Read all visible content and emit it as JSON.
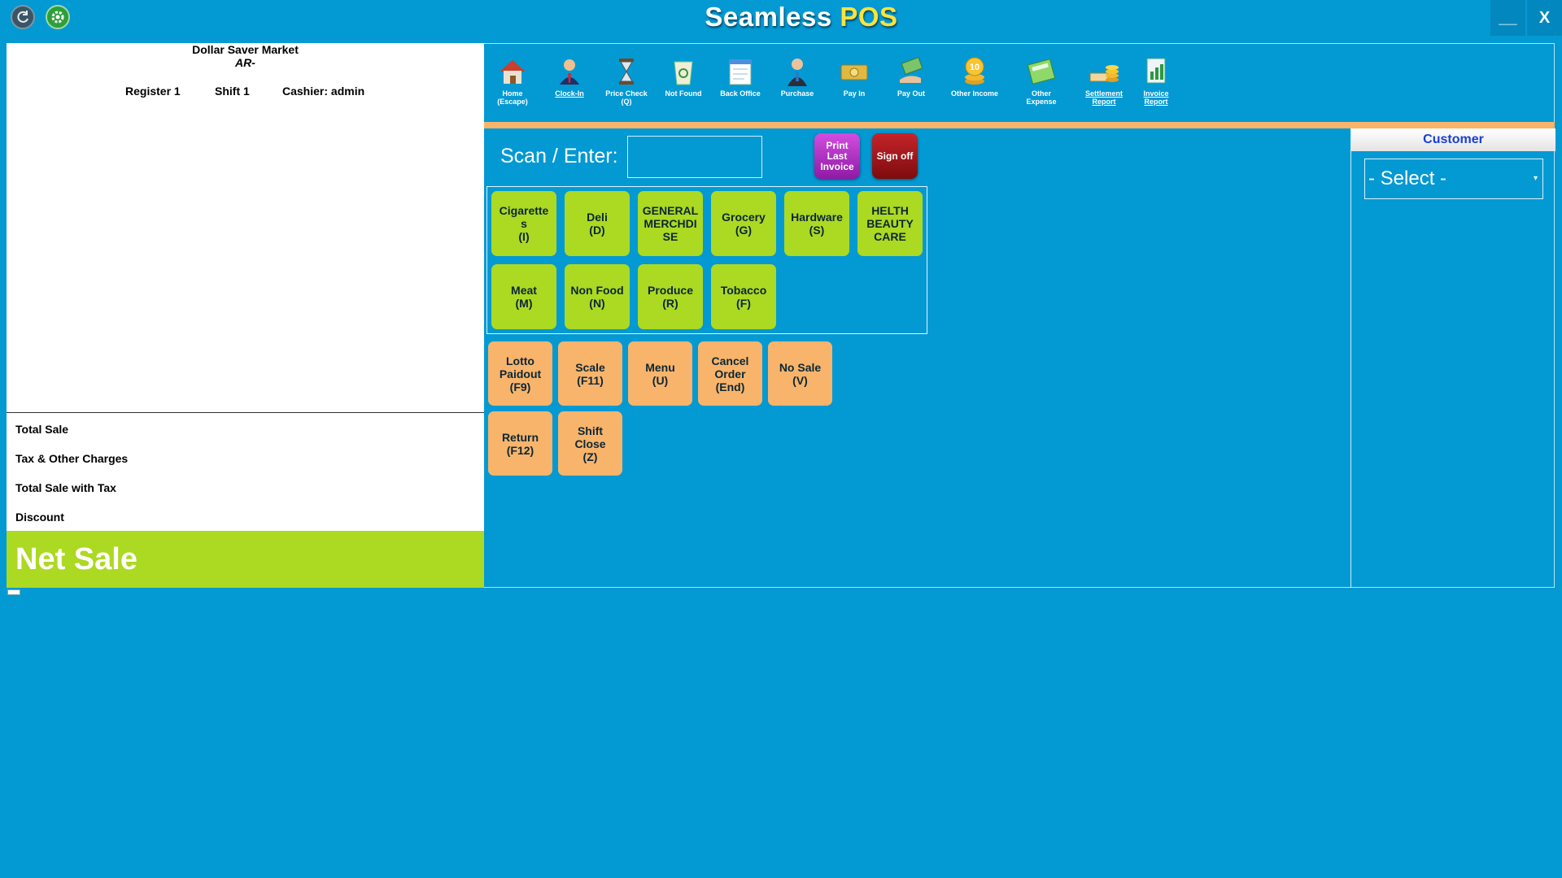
{
  "app": {
    "title_main": "Seamless ",
    "title_accent": "POS",
    "refresh_icon": "refresh-icon",
    "settings_icon": "gear-icon",
    "minimize_label": "__",
    "close_label": "X"
  },
  "receipt": {
    "store_name": "Dollar Saver Market",
    "store_sub": "AR-",
    "register": "Register 1",
    "shift": "Shift 1",
    "cashier": "Cashier: admin",
    "totals": [
      {
        "label": "Total Sale"
      },
      {
        "label": "Tax & Other Charges"
      },
      {
        "label": "Total Sale with Tax"
      },
      {
        "label": "Discount"
      }
    ],
    "net_sale_label": "Net Sale"
  },
  "toolbar": {
    "items": [
      {
        "label": "Home\n(Escape)",
        "icon": "home-icon",
        "glyph": "🏠"
      },
      {
        "label": "Clock-In",
        "icon": "clock-in-icon",
        "glyph": "👤"
      },
      {
        "label": "Price Check\n(Q)",
        "icon": "price-check-icon",
        "glyph": "⌛"
      },
      {
        "label": "Not Found",
        "icon": "recycle-bin-icon",
        "glyph": "🗑"
      },
      {
        "label": "Back Office",
        "icon": "back-office-icon",
        "glyph": "📝"
      },
      {
        "label": "Purchase",
        "icon": "purchase-icon",
        "glyph": "👔"
      },
      {
        "label": "Pay In",
        "icon": "pay-in-icon",
        "glyph": "💵"
      },
      {
        "label": "Pay Out",
        "icon": "pay-out-icon",
        "glyph": "💸"
      },
      {
        "label": "Other Income",
        "icon": "coins-icon",
        "glyph": "🪙"
      },
      {
        "label": "Other\nExpense",
        "icon": "calculator-icon",
        "glyph": "🧮"
      },
      {
        "label": "Settlement\nReport",
        "icon": "settlement-report-icon",
        "glyph": "💰"
      },
      {
        "label": "Invoice\nReport",
        "icon": "invoice-report-icon",
        "glyph": "📊"
      }
    ]
  },
  "scan": {
    "label": "Scan / Enter:",
    "value": "",
    "print_label": "Print\nLast\nInvoice",
    "signoff_label": "Sign off"
  },
  "departments": [
    {
      "label": "Cigarette\ns\n(I)"
    },
    {
      "label": "Deli\n(D)"
    },
    {
      "label": "GENERAL\nMERCHDI\nSE"
    },
    {
      "label": "Grocery\n(G)"
    },
    {
      "label": "Hardware\n(S)"
    },
    {
      "label": "HELTH\nBEAUTY\nCARE"
    },
    {
      "label": "Meat\n(M)"
    },
    {
      "label": "Non Food\n(N)"
    },
    {
      "label": "Produce\n(R)"
    },
    {
      "label": "Tobacco\n(F)"
    }
  ],
  "functions": [
    {
      "label": "Lotto\nPaidout\n(F9)"
    },
    {
      "label": "Scale\n(F11)"
    },
    {
      "label": "Menu\n(U)"
    },
    {
      "label": "Cancel\nOrder\n(End)"
    },
    {
      "label": "No Sale\n(V)"
    },
    {
      "label": "Return\n(F12)"
    },
    {
      "label": "Shift\nClose\n(Z)"
    }
  ],
  "customer": {
    "header": "Customer",
    "selected": "- Select -",
    "arrow": "▾"
  }
}
